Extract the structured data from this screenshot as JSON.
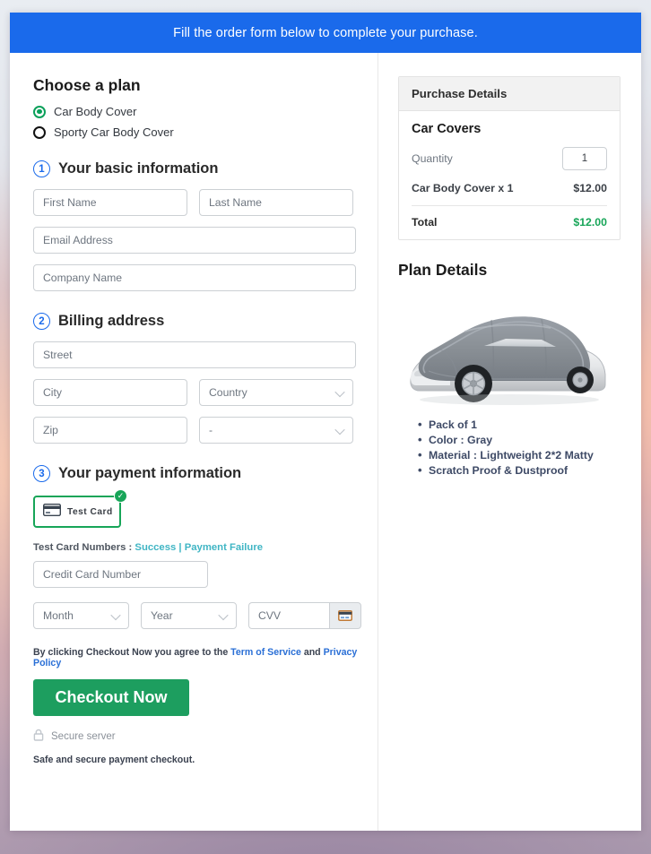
{
  "banner": {
    "text": "Fill the order form below to complete your purchase."
  },
  "plan": {
    "heading": "Choose a plan",
    "options": [
      {
        "label": "Car Body Cover",
        "selected": true
      },
      {
        "label": "Sporty Car Body Cover",
        "selected": false
      }
    ]
  },
  "steps": {
    "basic": {
      "num": "1",
      "title": "Your basic information"
    },
    "billing": {
      "num": "2",
      "title": "Billing address"
    },
    "payment": {
      "num": "3",
      "title": "Your payment information"
    }
  },
  "fields": {
    "first_name": "First Name",
    "last_name": "Last Name",
    "email": "Email Address",
    "company": "Company Name",
    "street": "Street",
    "city": "City",
    "country": "Country",
    "zip": "Zip",
    "state": "-",
    "credit_card": "Credit Card Number",
    "month": "Month",
    "year": "Year",
    "cvv": "CVV"
  },
  "test_card": {
    "label": "Test Card",
    "check": "✓",
    "numbers_prefix": "Test Card Numbers : ",
    "success_link": "Success",
    "separator": " | ",
    "failure_link": "Payment Failure"
  },
  "terms": {
    "prefix": "By clicking Checkout Now you agree to the ",
    "tos_link": "Term of Service",
    "mid": " and ",
    "privacy_link": "Privacy Policy"
  },
  "checkout": {
    "button_label": "Checkout Now",
    "secure_label": "Secure server",
    "safe_note": "Safe and secure payment checkout."
  },
  "purchase": {
    "panel_title": "Purchase Details",
    "product_group": "Car Covers",
    "quantity_label": "Quantity",
    "quantity_value": "1",
    "line_item_label": "Car Body Cover x 1",
    "line_item_price": "$12.00",
    "total_label": "Total",
    "total_price": "$12.00"
  },
  "plan_details": {
    "heading": "Plan Details",
    "image_alt": "covered-car-image",
    "bullets": [
      "Pack of 1",
      "Color : Gray",
      "Material : Lightweight 2*2 Matty",
      "Scratch Proof & Dustproof"
    ]
  },
  "colors": {
    "banner_blue": "#1a6aeb",
    "step_blue": "#1a6aeb",
    "green": "#17a558",
    "button_green": "#1d9e5f",
    "link_teal": "#3fb5c4",
    "link_blue": "#2a6fd6"
  }
}
